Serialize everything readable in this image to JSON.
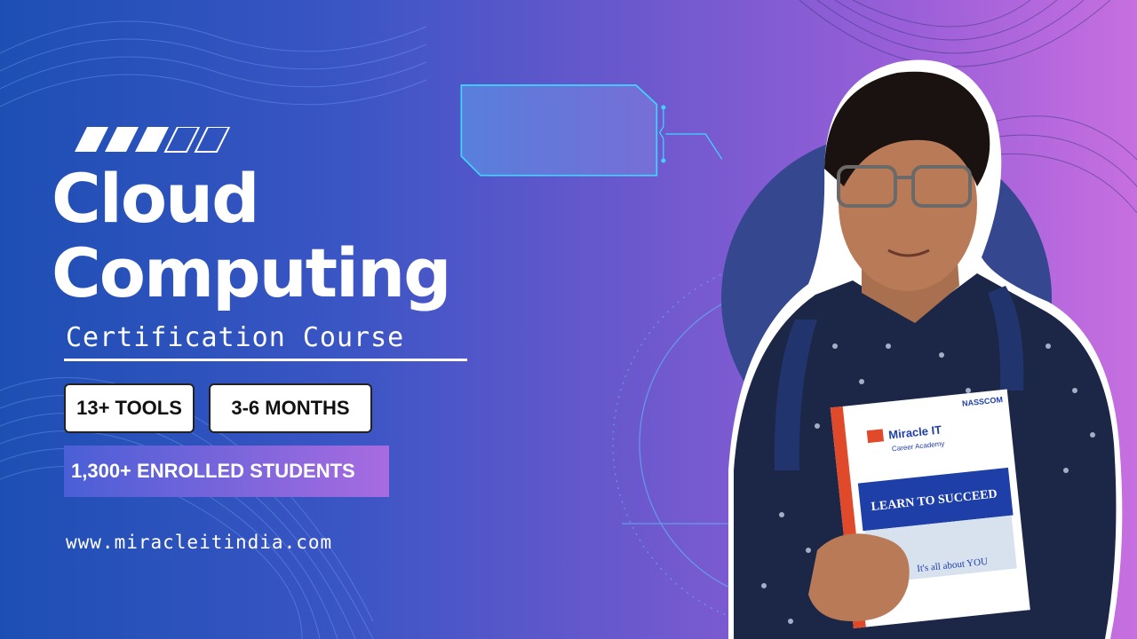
{
  "title_line1": "Cloud",
  "title_line2": "Computing",
  "subtitle": "Certification Course",
  "tag_tools": "13+ TOOLS",
  "tag_duration": "3-6 MONTHS",
  "enrolled": "1,300+ ENROLLED STUDENTS",
  "website": "www.miracleitindia.com",
  "book": {
    "brand": "Miracle IT",
    "brand_sub": "Career Academy",
    "publisher": "NASSCOM",
    "headline": "LEARN TO SUCCEED",
    "tagline": "It's all about YOU"
  },
  "colors": {
    "bg_left": "#1d4fb3",
    "bg_right": "#c76fe0",
    "circle": "#34478f",
    "shirt": "#1c2647",
    "accent_cyan": "#3fd6ff"
  }
}
